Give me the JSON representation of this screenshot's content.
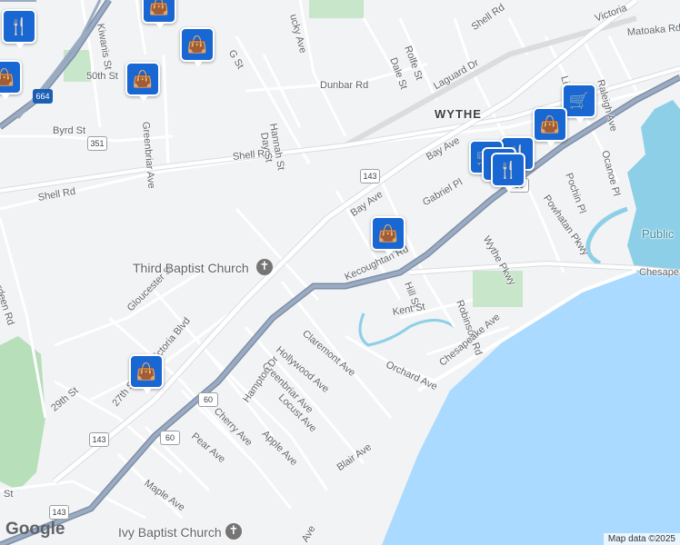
{
  "map": {
    "neighborhood_label": "WYTHE",
    "attribution": "Map data ©2025",
    "logo": "Google",
    "streets": [
      "Shell Rd",
      "Shell Rd",
      "Shell Rd",
      "Victoria",
      "Matoaka Rd",
      "Kiwanis St",
      "50th St",
      "Byrd St",
      "Greenbriar Ave",
      "G St",
      "Dunbar Rd",
      "Hannah St",
      "Day St",
      "Rolfe St",
      "Dale St",
      "Laguard Dr",
      "Little F",
      "Raleigh Ave",
      "Ocanoe Pl",
      "Pochin Pl",
      "Powhatan Pkwy",
      "Bay Ave",
      "Bay Ave",
      "Gabriel Pl",
      "Wythe Pkwy",
      "Kecoughtan Rd",
      "Hill St",
      "Robinson Rd",
      "Kent St",
      "Claremont Ave",
      "Hollywood Ave",
      "Orchard Ave",
      "Chesapeake Ave",
      "Chesapeake",
      "Gloucester St",
      "27th St",
      "Victoria Blvd",
      "Greenbriar Ave",
      "Hampton Dr",
      "Locust Ave",
      "Cherry Ave",
      "Apple Ave",
      "Pear Ave",
      "29th St",
      "Maple Ave",
      "Blair Ave",
      "Ave",
      "Aberdeen Rd",
      "ucky Ave",
      "St"
    ],
    "places": [
      "Third Baptist Church",
      "Ivy Baptist Church",
      "Public"
    ],
    "shields": [
      "664",
      "351",
      "143",
      "143",
      "60",
      "60",
      "143",
      "60"
    ],
    "pins": [
      "shopping-bag-icon",
      "shopping-bag-icon",
      "shopping-bag-icon",
      "shopping-bag-icon",
      "shopping-bag-icon",
      "shopping-bag-icon",
      "shopping-bag-icon",
      "restaurant-icon",
      "restaurant-icon",
      "shopping-cart-icon",
      "shopping-cart-icon",
      "restaurant-icon",
      "restaurant-icon"
    ],
    "pin_glyphs": {
      "bag": "👜",
      "fork": "🍴",
      "cart": "🛒",
      "cross": "✝"
    }
  }
}
